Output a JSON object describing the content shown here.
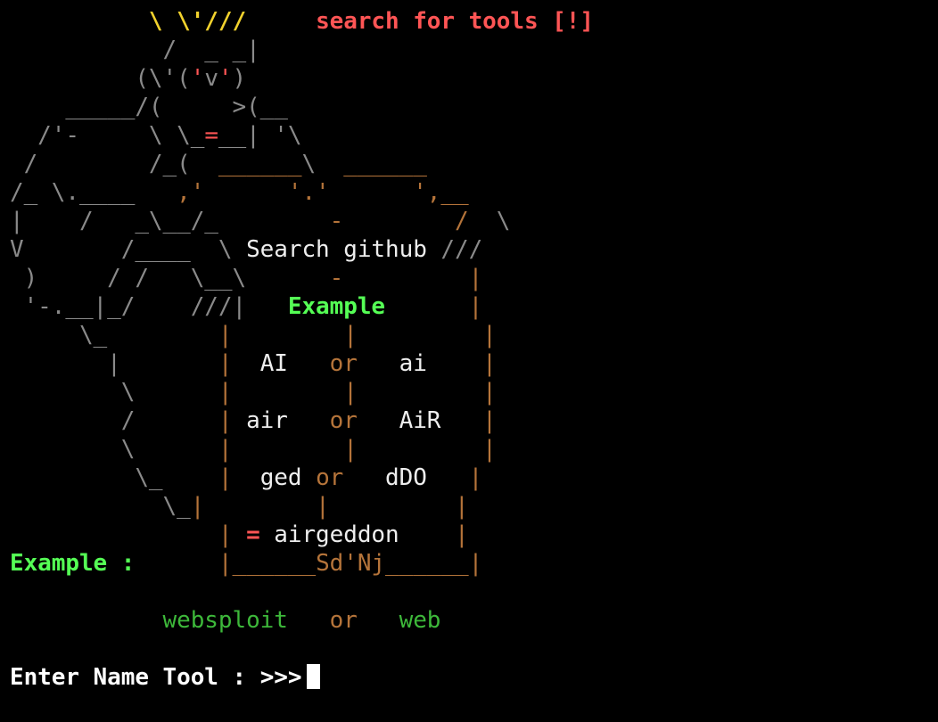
{
  "banner": {
    "heading": "search for tools [!]",
    "box_title": "Search github",
    "example_heading": "Example",
    "pairs": [
      {
        "left": "AI",
        "sep": "or",
        "right": "ai"
      },
      {
        "left": "air",
        "sep": "or",
        "right": "AiR"
      },
      {
        "left": "ged",
        "sep": "or",
        "right": "dDO"
      }
    ],
    "result_marker": "=",
    "result_value": "airgeddon",
    "signature": "Sd'Nj"
  },
  "example": {
    "label": "Example :",
    "left": "websploit",
    "sep": "or",
    "right": "web"
  },
  "prompt": {
    "label": "Enter Name Tool :",
    "arrow": ">>>"
  },
  "colors": {
    "background": "#000000",
    "art": "#8a8a8a",
    "heading_red": "#ff5555",
    "crown_yellow": "#f2d22d",
    "box_orange": "#b5743a",
    "example_green": "#55ff55",
    "websploit_green": "#3db83a"
  }
}
